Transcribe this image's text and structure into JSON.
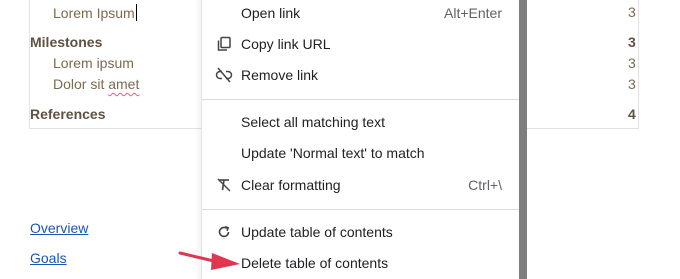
{
  "toc": {
    "rows": [
      {
        "text": "Lorem Ipsum",
        "num": "3",
        "kind": "sub"
      },
      {
        "text": "Milestones",
        "num": "3",
        "kind": "head"
      },
      {
        "text": "Lorem ipsum",
        "num": "3",
        "kind": "sub"
      },
      {
        "text": "Dolor sit ",
        "squiggle": "amet",
        "num": "3",
        "kind": "sub"
      },
      {
        "text": "References",
        "num": "4",
        "kind": "head"
      }
    ]
  },
  "links": [
    "Overview",
    "Goals"
  ],
  "menu": {
    "items": [
      {
        "label": "Open link",
        "shortcut": "Alt+Enter",
        "icon": "none"
      },
      {
        "label": "Copy link URL",
        "shortcut": "",
        "icon": "copy-icon"
      },
      {
        "label": "Remove link",
        "shortcut": "",
        "icon": "link-off-icon"
      },
      {
        "label": "Select all matching text",
        "shortcut": "",
        "icon": "none"
      },
      {
        "label": "Update 'Normal text' to match",
        "shortcut": "",
        "icon": "none"
      },
      {
        "label": "Clear formatting",
        "shortcut": "Ctrl+\\",
        "icon": "clear-format-icon"
      },
      {
        "label": "Update table of contents",
        "shortcut": "",
        "icon": "refresh-icon"
      },
      {
        "label": "Delete table of contents",
        "shortcut": "",
        "icon": "none"
      }
    ]
  },
  "colors": {
    "annotation_arrow": "#e0364f",
    "link": "#1a56b0"
  }
}
